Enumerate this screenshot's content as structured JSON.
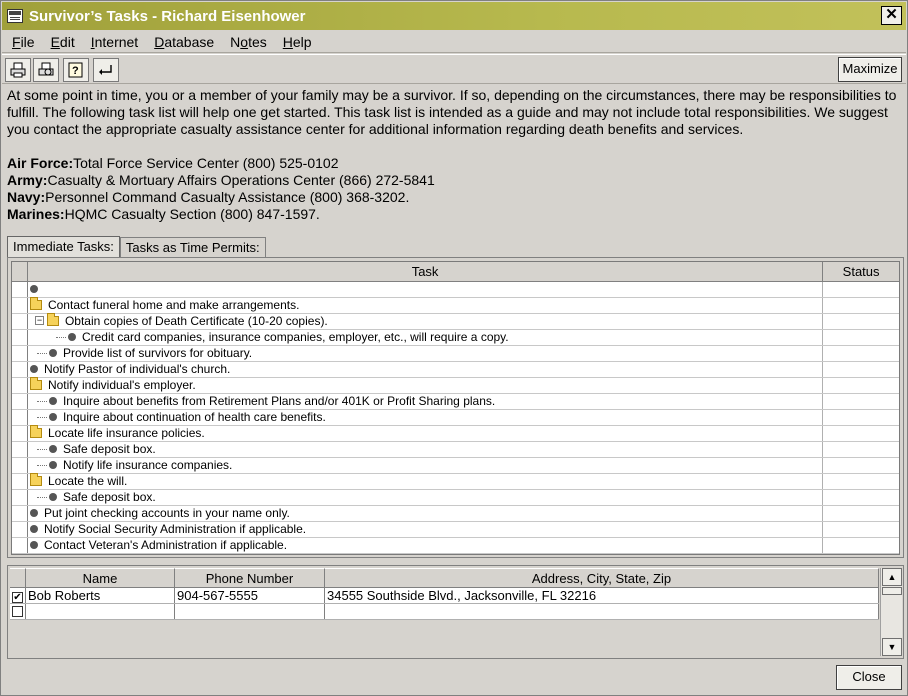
{
  "window": {
    "title": "Survivor’s Tasks - Richard Eisenhower",
    "close_glyph": "✕"
  },
  "menu": [
    {
      "accel": "F",
      "rest": "ile"
    },
    {
      "accel": "E",
      "rest": "dit"
    },
    {
      "accel": "I",
      "rest": "nternet"
    },
    {
      "accel": "D",
      "rest": "atabase"
    },
    {
      "prefix": "N",
      "accel": "o",
      "rest": "tes"
    },
    {
      "accel": "H",
      "rest": "elp"
    }
  ],
  "toolbar": {
    "icons": [
      "print-icon",
      "print-preview-icon",
      "help-icon",
      "back-arrow-icon"
    ],
    "maximize_label": "Maximize"
  },
  "intro_text": "At some point in time, you or a member of your family may be a survivor.  If so, depending on the circumstances, there may be responsibilities to fulfill.  The following task list will help one get started.  This task list is intended as a guide and may not include total responsibilities. We suggest you contact the appropriate casualty assistance center for additional information regarding death benefits and services.",
  "contacts": [
    {
      "branch": "Air Force:",
      "info": "Total Force Service Center  (800) 525-0102"
    },
    {
      "branch": "Army:",
      "info": "Casualty & Mortuary Affairs Operations Center  (866) 272-5841"
    },
    {
      "branch": "Navy:",
      "info": "Personnel Command Casualty Assistance  (800) 368-3202."
    },
    {
      "branch": "Marines:",
      "info": "HQMC Casualty Section  (800) 847-1597."
    }
  ],
  "tabs": [
    {
      "label": "Immediate Tasks:",
      "active": true
    },
    {
      "label": "Tasks as Time Permits:",
      "active": false
    }
  ],
  "task_grid": {
    "headers": {
      "task": "Task",
      "status": "Status"
    },
    "rows": [
      {
        "level": 0,
        "icon": "bullet",
        "text": "",
        "status": ""
      },
      {
        "level": 0,
        "icon": "folder",
        "text": "Contact funeral home and make arrangements.",
        "status": ""
      },
      {
        "level": 1,
        "icon": "folder",
        "expander": "−",
        "text": "Obtain copies of Death Certificate (10-20 copies).",
        "status": ""
      },
      {
        "level": 2,
        "icon": "bullet",
        "text": "Credit card companies, insurance companies, employer, etc., will require a copy.",
        "status": ""
      },
      {
        "level": 1,
        "icon": "bullet",
        "text": "Provide list of survivors for obituary.",
        "status": ""
      },
      {
        "level": 0,
        "icon": "bullet",
        "text": "Notify Pastor of individual's church.",
        "status": ""
      },
      {
        "level": 0,
        "icon": "folder",
        "text": "Notify individual's employer.",
        "status": ""
      },
      {
        "level": 1,
        "icon": "bullet",
        "text": "Inquire about benefits from Retirement Plans and/or 401K or Profit Sharing plans.",
        "status": ""
      },
      {
        "level": 1,
        "icon": "bullet",
        "text": "Inquire about continuation of health care benefits.",
        "status": ""
      },
      {
        "level": 0,
        "icon": "folder",
        "text": "Locate life insurance policies.",
        "status": ""
      },
      {
        "level": 1,
        "icon": "bullet",
        "text": "Safe deposit box.",
        "status": ""
      },
      {
        "level": 1,
        "icon": "bullet",
        "text": "Notify life insurance companies.",
        "status": ""
      },
      {
        "level": 0,
        "icon": "folder",
        "text": "Locate the will.",
        "status": ""
      },
      {
        "level": 1,
        "icon": "bullet",
        "text": "Safe deposit box.",
        "status": ""
      },
      {
        "level": 0,
        "icon": "bullet",
        "text": "Put joint checking accounts in your name only.",
        "status": ""
      },
      {
        "level": 0,
        "icon": "bullet",
        "text": "Notify Social Security Administration if applicable.",
        "status": ""
      },
      {
        "level": 0,
        "icon": "bullet",
        "text": "Contact Veteran's Administration if applicable.",
        "status": ""
      }
    ]
  },
  "people_grid": {
    "headers": [
      "Name",
      "Phone Number",
      "Address, City, State, Zip"
    ],
    "rows": [
      {
        "checked": true,
        "name": "Bob Roberts",
        "phone": "904-567-5555",
        "address": "34555  Southside Blvd., Jacksonville, FL 32216"
      },
      {
        "checked": false,
        "name": "",
        "phone": "",
        "address": ""
      }
    ],
    "check_glyph": "✔"
  },
  "scroll": {
    "up_glyph": "▲",
    "down_glyph": "▼"
  },
  "close_button_label": "Close"
}
